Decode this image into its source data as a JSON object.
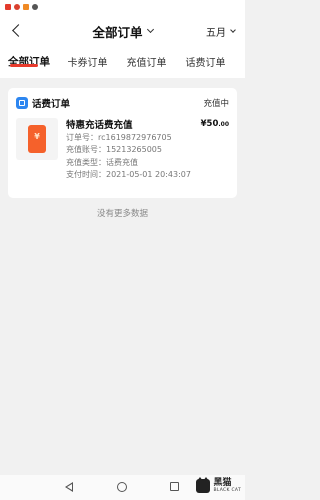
{
  "header": {
    "title": "全部订单",
    "month": "五月"
  },
  "tabs": [
    {
      "label": "全部订单",
      "active": true
    },
    {
      "label": "卡券订单",
      "active": false
    },
    {
      "label": "充值订单",
      "active": false
    },
    {
      "label": "话费订单",
      "active": false
    }
  ],
  "order": {
    "type_label": "话费订单",
    "status": "充值中",
    "product_name": "特惠充话费充值",
    "price_int": "¥50",
    "price_dec": ".00",
    "rows": [
      "订单号：rc1619872976705",
      "充值账号：15213265005",
      "充值类型：话费充值",
      "支付时间：2021-05-01 20:43:07"
    ],
    "image_glyph": "¥"
  },
  "footer": {
    "no_more": "没有更多数据"
  },
  "watermark": {
    "cn": "黑猫",
    "en": "BLACK CAT"
  },
  "colors": {
    "accent": "#e83a2c",
    "type_icon": "#2d86f0",
    "product": "#f5612b"
  }
}
